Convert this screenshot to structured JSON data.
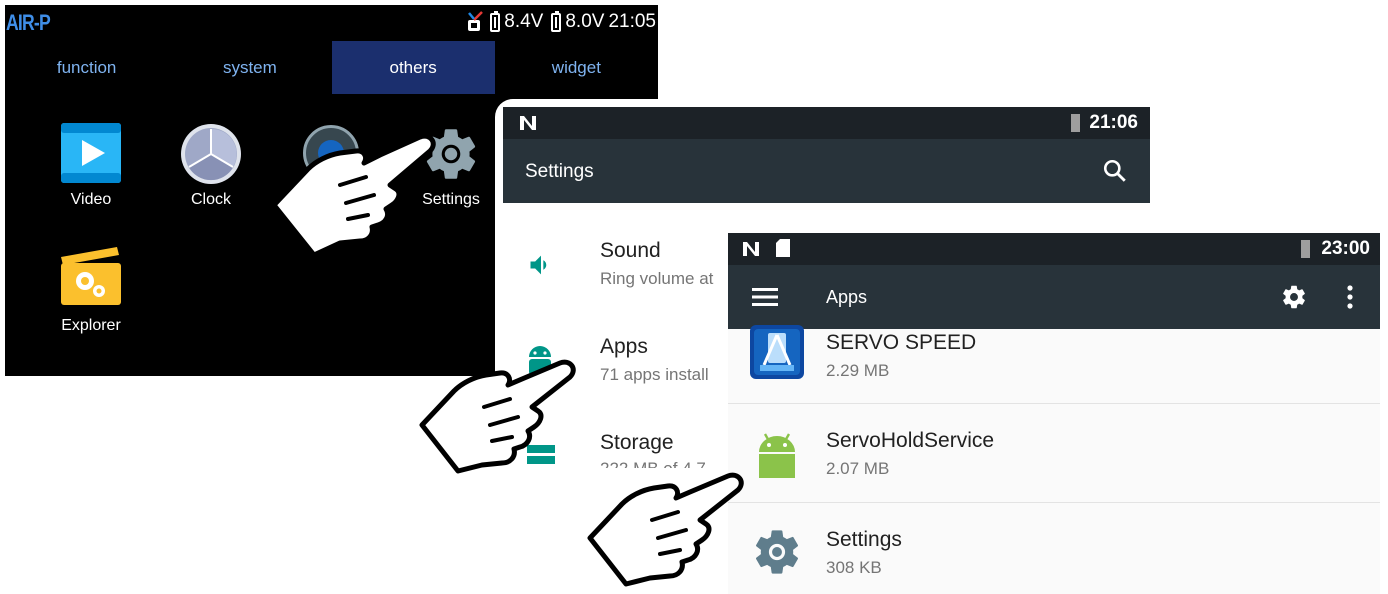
{
  "launcher": {
    "brand": "AIR-P",
    "voltage_1": "8.4V",
    "voltage_2": "8.0V",
    "time": "21:05",
    "tabs": [
      {
        "label": "function"
      },
      {
        "label": "system"
      },
      {
        "label": "others",
        "active": true
      },
      {
        "label": "widget"
      }
    ],
    "apps": {
      "video": "Video",
      "clock": "Clock",
      "settings": "Settings",
      "explorer": "Explorer"
    }
  },
  "settings_screen": {
    "time": "21:06",
    "title": "Settings",
    "items": [
      {
        "title": "Sound",
        "subtitle": "Ring volume at"
      },
      {
        "title": "Apps",
        "subtitle": "71 apps install"
      },
      {
        "title": "Storage",
        "subtitle": "222 MB of 4.7"
      }
    ]
  },
  "apps_screen": {
    "time": "23:00",
    "title": "Apps",
    "apps": [
      {
        "name": "SERVO SPEED",
        "size": "2.29 MB"
      },
      {
        "name": "ServoHoldService",
        "size": "2.07 MB"
      },
      {
        "name": "Settings",
        "size": "308 KB"
      }
    ]
  },
  "colors": {
    "android_statusbar": "#1c2227",
    "android_appbar": "#28333a",
    "launcher_tab_active": "#1b2f6e",
    "accent_teal": "#009688",
    "android_green": "#8bc34a"
  }
}
